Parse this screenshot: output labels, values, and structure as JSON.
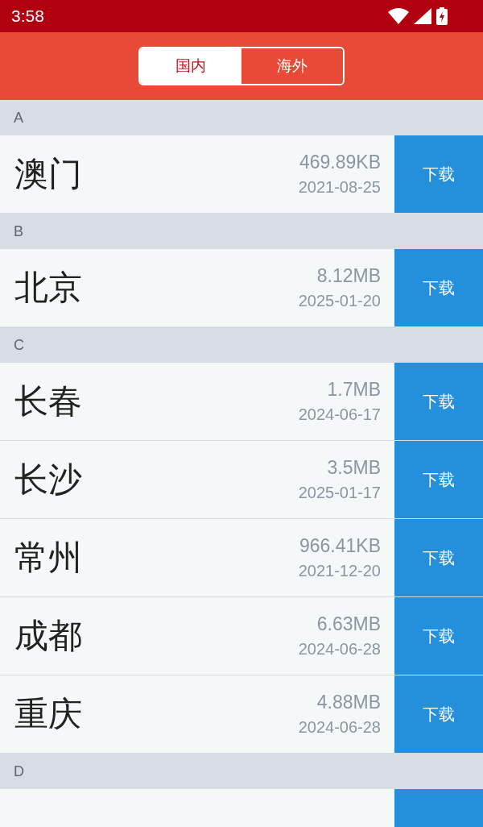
{
  "status_bar": {
    "time": "3:58"
  },
  "tabs": [
    {
      "label": "国内",
      "selected": true
    },
    {
      "label": "海外",
      "selected": false
    }
  ],
  "sections": [
    {
      "letter": "A",
      "cities": [
        {
          "name": "澳门",
          "size": "469.89KB",
          "date": "2021-08-25",
          "button": "下载"
        }
      ]
    },
    {
      "letter": "B",
      "cities": [
        {
          "name": "北京",
          "size": "8.12MB",
          "date": "2025-01-20",
          "button": "下载"
        }
      ]
    },
    {
      "letter": "C",
      "cities": [
        {
          "name": "长春",
          "size": "1.7MB",
          "date": "2024-06-17",
          "button": "下载"
        },
        {
          "name": "长沙",
          "size": "3.5MB",
          "date": "2025-01-17",
          "button": "下载"
        },
        {
          "name": "常州",
          "size": "966.41KB",
          "date": "2021-12-20",
          "button": "下载"
        },
        {
          "name": "成都",
          "size": "6.63MB",
          "date": "2024-06-28",
          "button": "下载"
        },
        {
          "name": "重庆",
          "size": "4.88MB",
          "date": "2024-06-28",
          "button": "下载"
        }
      ]
    },
    {
      "letter": "D",
      "cities": [
        {
          "kind": "cut"
        }
      ]
    }
  ]
}
